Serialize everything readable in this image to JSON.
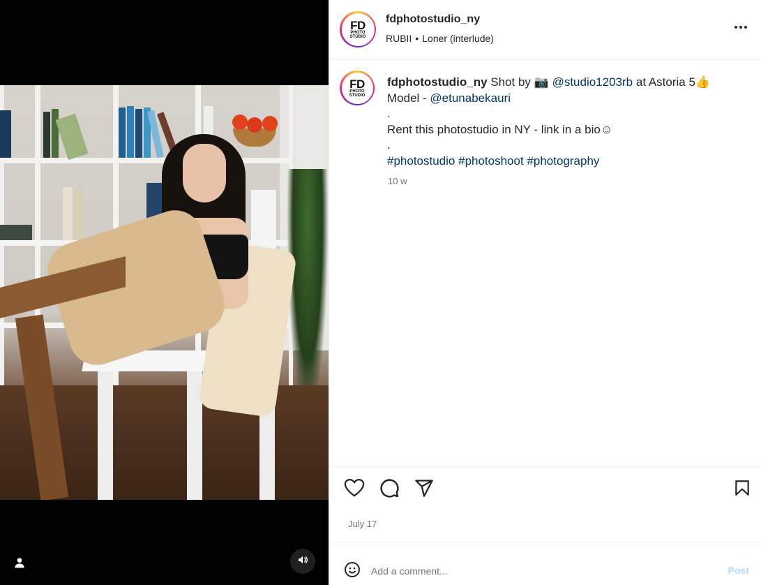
{
  "post": {
    "author": "fdphotostudio_ny",
    "audio": {
      "artist": "RUBII",
      "separator": "•",
      "track": "Loner (interlude)"
    },
    "avatar_logo": {
      "main": "FD",
      "line1": "PHOTO",
      "line2": "STUDIO"
    },
    "caption": {
      "author": "fdphotostudio_ny",
      "shot_by": "Shot by",
      "camera_emoji": "📷",
      "photographer": "@studio1203rb",
      "location_text": "at Astoria 5👍",
      "model_prefix": "Model -",
      "model": "@etunabekauri",
      "dot1": ".",
      "rent_text": "Rent this photostudio in NY - link in a bio☺",
      "dot2": ".",
      "hashtags": [
        "#photostudio",
        "#photoshoot",
        "#photography"
      ],
      "time_ago": "10 w"
    },
    "date": {
      "month": "July",
      "day": "17"
    }
  },
  "comment": {
    "placeholder": "Add a comment...",
    "post_label": "Post"
  },
  "icons": {
    "more": "more-options-icon",
    "like": "heart-icon",
    "comment": "comment-bubble-icon",
    "share": "paper-plane-icon",
    "save": "bookmark-icon",
    "emoji": "smiley-icon",
    "audio": "speaker-icon",
    "tagged": "person-icon"
  },
  "colors": {
    "link": "#00376b",
    "post_button_disabled": "#b2dffc",
    "secondary_text": "#737373"
  }
}
